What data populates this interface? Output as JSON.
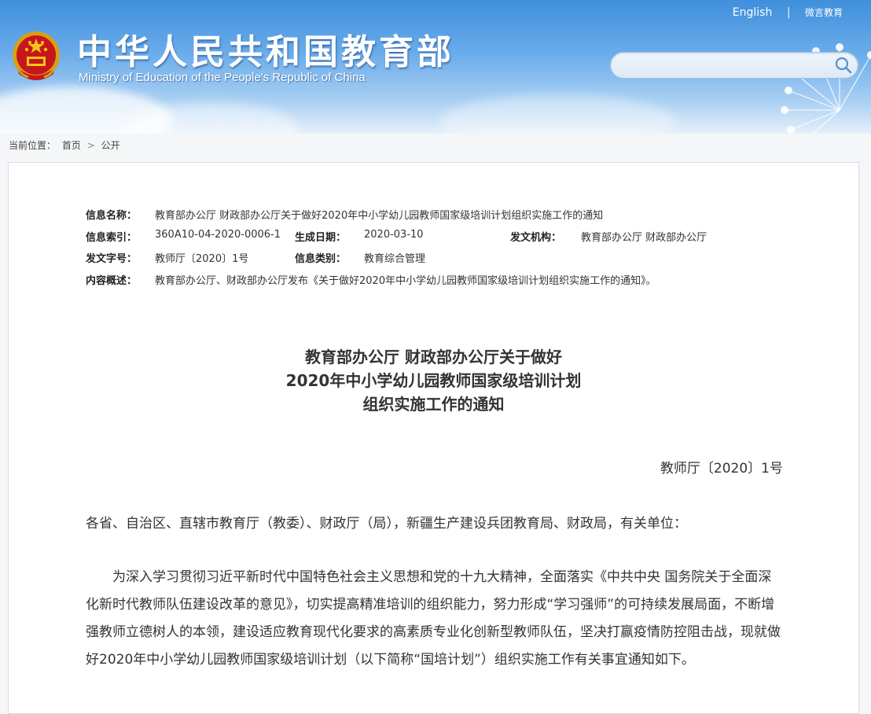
{
  "header": {
    "title_cn": "中华人民共和国教育部",
    "title_en": "Ministry of Education of the People's Republic of China",
    "links": {
      "english": "English",
      "separator": "|",
      "weixin": "微言教育"
    },
    "search": {
      "placeholder": ""
    },
    "icons": {
      "emblem": "national-emblem-icon",
      "search": "search-icon"
    },
    "colors": {
      "sky": "#4a95df",
      "accent_red": "#c8161d"
    }
  },
  "breadcrumb": {
    "prefix": "当前位置：",
    "home": "首页",
    "arrow": ">",
    "current": "公开"
  },
  "meta": {
    "name_label": "信息名称：",
    "name_value": "教育部办公厅 财政部办公厅关于做好2020年中小学幼儿园教师国家级培训计划组织实施工作的通知",
    "index_label": "信息索引：",
    "index_value": "360A10-04-2020-0006-1",
    "date_label": "生成日期：",
    "date_value": "2020-03-10",
    "org_label": "发文机构：",
    "org_value": "教育部办公厅 财政部办公厅",
    "docno_label": "发文字号：",
    "docno_value": "教师厅〔2020〕1号",
    "category_label": "信息类别：",
    "category_value": "教育综合管理",
    "summary_label": "内容概述：",
    "summary_value": "教育部办公厅、财政部办公厅发布《关于做好2020年中小学幼儿园教师国家级培训计划组织实施工作的通知》。"
  },
  "article": {
    "title_lines": [
      "教育部办公厅 财政部办公厅关于做好",
      "2020年中小学幼儿园教师国家级培训计划",
      "组织实施工作的通知"
    ],
    "doc_number": "教师厅〔2020〕1号",
    "addressee": "各省、自治区、直辖市教育厅（教委）、财政厅（局），新疆生产建设兵团教育局、财政局，有关单位：",
    "paragraph1": "为深入学习贯彻习近平新时代中国特色社会主义思想和党的十九大精神，全面落实《中共中央 国务院关于全面深化新时代教师队伍建设改革的意见》，切实提高精准培训的组织能力，努力形成“学习强师”的可持续发展局面，不断增强教师立德树人的本领，建设适应教育现代化要求的高素质专业化创新型教师队伍，坚决打赢疫情防控阻击战，现就做好2020年中小学幼儿园教师国家级培训计划（以下简称“国培计划”）组织实施工作有关事宜通知如下。"
  }
}
